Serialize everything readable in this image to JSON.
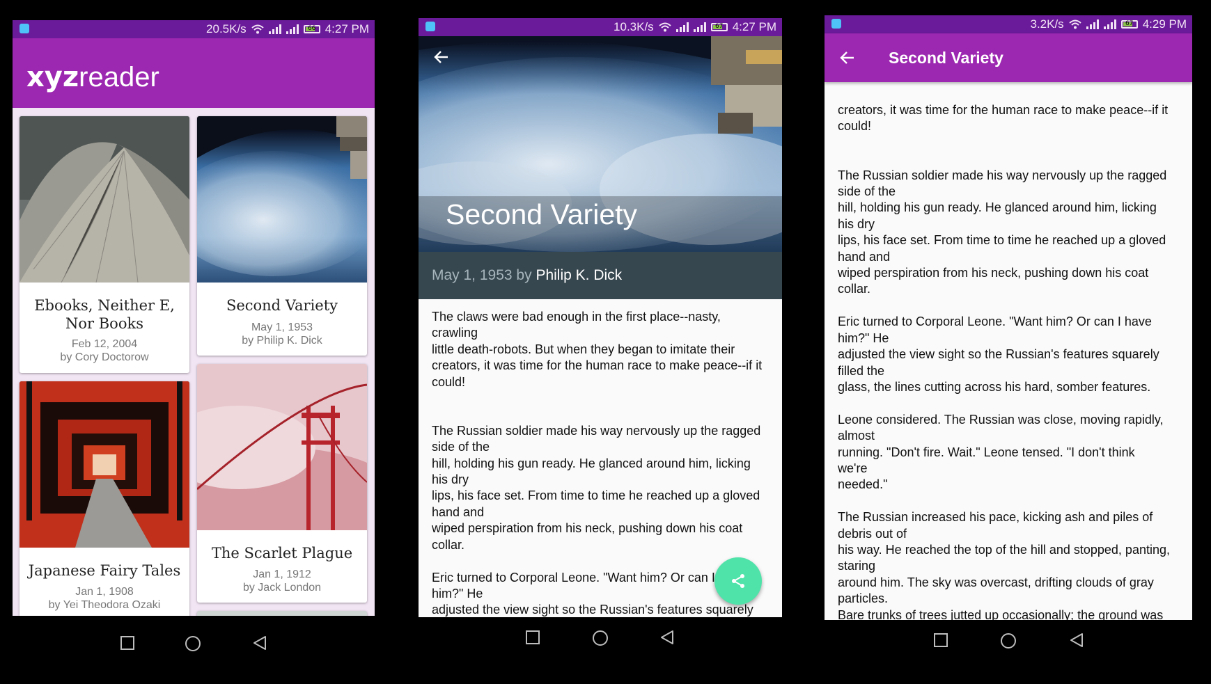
{
  "status_bars": [
    {
      "speed": "20.5K/s",
      "battery": "66",
      "time": "4:27 PM"
    },
    {
      "speed": "10.3K/s",
      "battery": "67",
      "time": "4:27 PM"
    },
    {
      "speed": "3.2K/s",
      "battery": "67",
      "time": "4:29 PM"
    }
  ],
  "list_screen": {
    "logo_bold": "xyz",
    "logo_light": "reader",
    "toolbar_color": "#9c27b0",
    "articles": [
      {
        "title": "Ebooks, Neither E, Nor Books",
        "date": "Feb 12, 2004",
        "author": "by Cory Doctorow",
        "image": "sydney-opera-house-roof"
      },
      {
        "title": "Second Variety",
        "date": "May 1, 1953",
        "author": "by Philip K. Dick",
        "image": "earth-from-space-station"
      },
      {
        "title": "Japanese Fairy Tales",
        "date": "Jan 1, 1908",
        "author": "by Yei Theodora Ozaki",
        "image": "torii-gate-tunnel"
      },
      {
        "title": "The Scarlet Plague",
        "date": "Jan 1, 1912",
        "author": "by Jack London",
        "image": "golden-gate-bridge-in-fog"
      }
    ]
  },
  "detail_screen": {
    "title": "Second Variety",
    "date": "May 1, 1953",
    "by": "by",
    "author": "Philip K. Dick",
    "meta_bar_color": "#37474f",
    "fab_color": "#4fe3a9",
    "fab_icon": "share-icon",
    "body": "The claws were bad enough in the first place--nasty,\ncrawling\nlittle death-robots. But when they began to imitate their\ncreators, it was time for the human race to make peace--if it\ncould!\n\n\nThe Russian soldier made his way nervously up the ragged\nside of the\nhill, holding his gun ready. He glanced around him, licking\nhis dry\nlips, his face set. From time to time he reached up a gloved\nhand and\nwiped perspiration from his neck, pushing down his coat\ncollar.\n\nEric turned to Corporal Leone. \"Want him? Or can I have\nhim?\" He\nadjusted the view sight so the Russian's features squarely"
  },
  "scrolled_screen": {
    "toolbar_title": "Second Variety",
    "body": "creators, it was time for the human race to make peace--if it\ncould!\n\n\nThe Russian soldier made his way nervously up the ragged\nside of the\nhill, holding his gun ready. He glanced around him, licking\nhis dry\nlips, his face set. From time to time he reached up a gloved\nhand and\nwiped perspiration from his neck, pushing down his coat\ncollar.\n\nEric turned to Corporal Leone. \"Want him? Or can I have\nhim?\" He\nadjusted the view sight so the Russian's features squarely\nfilled the\nglass, the lines cutting across his hard, somber features.\n\nLeone considered. The Russian was close, moving rapidly,\nalmost\nrunning. \"Don't fire. Wait.\" Leone tensed. \"I don't think\nwe're\nneeded.\"\n\nThe Russian increased his pace, kicking ash and piles of\ndebris out of\nhis way. He reached the top of the hill and stopped, panting,\nstaring\naround him. The sky was overcast, drifting clouds of gray\nparticles.\nBare trunks of trees jutted up occasionally; the ground was\nlevel and"
  }
}
